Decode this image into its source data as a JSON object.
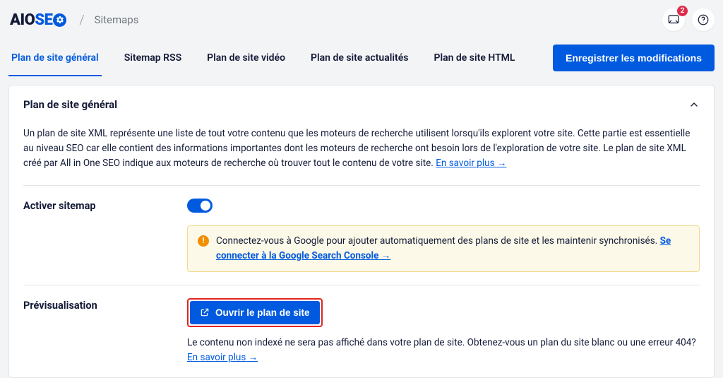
{
  "breadcrumb": {
    "logo_text_1": "AIO",
    "logo_text_2": "SE",
    "page": "Sitemaps"
  },
  "header": {
    "notification_count": "2"
  },
  "tabs": {
    "items": [
      {
        "label": "Plan de site général",
        "active": true
      },
      {
        "label": "Sitemap RSS",
        "active": false
      },
      {
        "label": "Plan de site vidéo",
        "active": false
      },
      {
        "label": "Plan de site actualités",
        "active": false
      },
      {
        "label": "Plan de site HTML",
        "active": false
      }
    ],
    "save_label": "Enregistrer les modifications"
  },
  "panel": {
    "title": "Plan de site général",
    "description": "Un plan de site XML représente une liste de tout votre contenu que les moteurs de recherche utilisent lorsqu'ils explorent votre site. Cette partie est essentielle au niveau SEO car elle contient des informations importantes dont les moteurs de recherche ont besoin lors de l'exploration de votre site. Le plan de site XML créé par All in One SEO indique aux moteurs de recherche où trouver tout le contenu de votre site.",
    "learn_more": "En savoir plus",
    "enable": {
      "label": "Activer sitemap",
      "value": true
    },
    "notice": {
      "text": "Connectez-vous à Google pour ajouter automatiquement des plans de site et les maintenir synchronisés. ",
      "link": "Se connecter à la Google Search Console →"
    },
    "preview": {
      "label": "Prévisualisation",
      "button": "Ouvrir le plan de site",
      "description": "Le contenu non indexé ne sera pas affiché dans votre plan de site. Obtenez-vous un plan du site blanc ou une erreur 404? ",
      "learn_more": "En savoir plus"
    }
  }
}
